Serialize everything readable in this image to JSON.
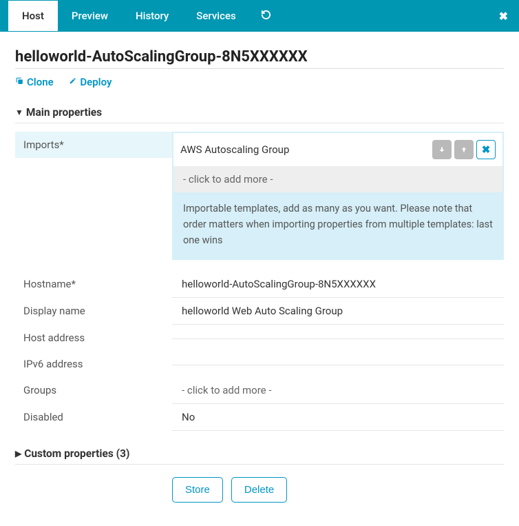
{
  "tabs": {
    "items": [
      "Host",
      "Preview",
      "History",
      "Services"
    ],
    "active_index": 0
  },
  "title": "helloworld-AutoScalingGroup-8N5XXXXXX",
  "actions": {
    "clone": "Clone",
    "deploy": "Deploy"
  },
  "sections": {
    "main": {
      "label": "Main properties",
      "fields": {
        "imports_label": "Imports*",
        "imports_value": "AWS Autoscaling Group",
        "imports_addmore": "- click to add more -",
        "imports_help": "Importable templates, add as many as you want. Please note that order matters when importing properties from multiple templates: last one wins",
        "hostname_label": "Hostname*",
        "hostname_value": "helloworld-AutoScalingGroup-8N5XXXXXX",
        "displayname_label": "Display name",
        "displayname_value": "helloworld Web Auto Scaling Group",
        "hostaddr_label": "Host address",
        "hostaddr_value": "",
        "ipv6_label": "IPv6 address",
        "ipv6_value": "",
        "groups_label": "Groups",
        "groups_addmore": "- click to add more -",
        "disabled_label": "Disabled",
        "disabled_value": "No"
      }
    },
    "custom": {
      "label": "Custom properties (3)"
    }
  },
  "buttons": {
    "store": "Store",
    "delete": "Delete"
  },
  "icons": {
    "refresh": "↻",
    "close": "✖",
    "clone": "⎘",
    "deploy": "🔧",
    "caret_down": "▼",
    "caret_right": "▶",
    "arrow_down": "↓",
    "arrow_up": "↑",
    "remove": "✖"
  }
}
